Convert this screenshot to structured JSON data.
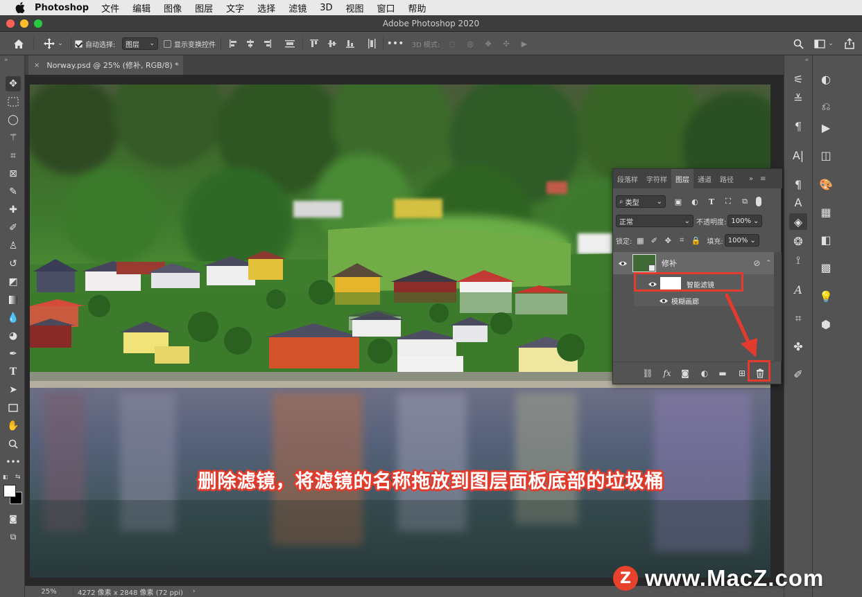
{
  "menubar": {
    "app": "Photoshop",
    "items": [
      "文件",
      "编辑",
      "图像",
      "图层",
      "文字",
      "选择",
      "滤镜",
      "3D",
      "视图",
      "窗口",
      "帮助"
    ]
  },
  "window": {
    "title": "Adobe Photoshop 2020"
  },
  "options": {
    "auto_select_label": "自动选择:",
    "auto_select_value": "图层",
    "show_transform_label": "显示变换控件",
    "mode_3d_label": "3D 模式:"
  },
  "document": {
    "tab_label": "Norway.psd @ 25% (修补, RGB/8) *"
  },
  "status": {
    "zoom": "25%",
    "info": "4272 像素 x 2848 像素 (72 ppi)"
  },
  "layers_panel": {
    "tabs": [
      "段落样",
      "字符样",
      "图层",
      "通道",
      "路径"
    ],
    "active_tab": "图层",
    "filter_kind": "类型",
    "blend_mode": "正常",
    "opacity_label": "不透明度:",
    "opacity_value": "100%",
    "lock_label": "锁定:",
    "fill_label": "填充:",
    "fill_value": "100%",
    "layer_name": "修补",
    "smart_filters_label": "智能滤镜",
    "filter_item_label": "模糊画廊"
  },
  "caption": "删除滤镜，将滤镜的名称拖放到图层面板底部的垃圾桶",
  "watermark": {
    "logo_letter": "Z",
    "text": "www.MacZ.com"
  },
  "colors": {
    "highlight_red": "#e53b2f",
    "panel_gray": "#535353"
  }
}
